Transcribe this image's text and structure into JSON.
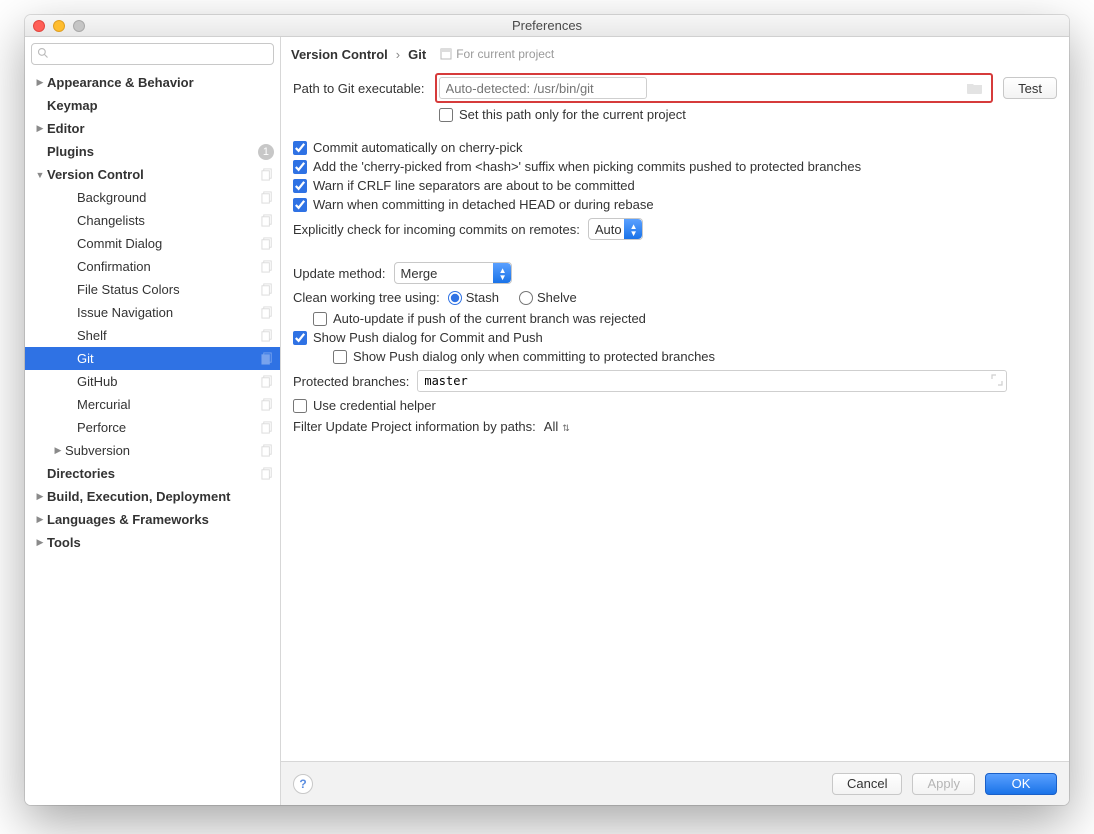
{
  "window": {
    "title": "Preferences"
  },
  "search": {
    "placeholder": ""
  },
  "sidebar": {
    "items": [
      {
        "label": "Appearance & Behavior",
        "bold": true,
        "arrow": "▶",
        "lvl": 0
      },
      {
        "label": "Keymap",
        "bold": true,
        "lvl": 0,
        "noarrow": true
      },
      {
        "label": "Editor",
        "bold": true,
        "arrow": "▶",
        "lvl": 0
      },
      {
        "label": "Plugins",
        "bold": true,
        "lvl": 0,
        "noarrow": true,
        "badge": "1"
      },
      {
        "label": "Version Control",
        "bold": true,
        "arrow": "▼",
        "lvl": 0,
        "copy": true
      },
      {
        "label": "Background",
        "lvl": 2,
        "copy": true
      },
      {
        "label": "Changelists",
        "lvl": 2,
        "copy": true
      },
      {
        "label": "Commit Dialog",
        "lvl": 2,
        "copy": true
      },
      {
        "label": "Confirmation",
        "lvl": 2,
        "copy": true
      },
      {
        "label": "File Status Colors",
        "lvl": 2,
        "copy": true
      },
      {
        "label": "Issue Navigation",
        "lvl": 2,
        "copy": true
      },
      {
        "label": "Shelf",
        "lvl": 2,
        "copy": true
      },
      {
        "label": "Git",
        "lvl": 2,
        "copy": true,
        "selected": true
      },
      {
        "label": "GitHub",
        "lvl": 2,
        "copy": true
      },
      {
        "label": "Mercurial",
        "lvl": 2,
        "copy": true
      },
      {
        "label": "Perforce",
        "lvl": 2,
        "copy": true
      },
      {
        "label": "Subversion",
        "lvl": 1,
        "arrow": "▶",
        "copy": true
      },
      {
        "label": "Directories",
        "bold": true,
        "lvl": 0,
        "noarrow": true,
        "copy": true
      },
      {
        "label": "Build, Execution, Deployment",
        "bold": true,
        "arrow": "▶",
        "lvl": 0
      },
      {
        "label": "Languages & Frameworks",
        "bold": true,
        "arrow": "▶",
        "lvl": 0
      },
      {
        "label": "Tools",
        "bold": true,
        "arrow": "▶",
        "lvl": 0
      }
    ]
  },
  "breadcrumb": {
    "root": "Version Control",
    "leaf": "Git",
    "hint": "For current project"
  },
  "path": {
    "label": "Path to Git executable:",
    "placeholder": "Auto-detected: /usr/bin/git",
    "test": "Test",
    "only_this_project": "Set this path only for the current project"
  },
  "checks": {
    "cherry_pick": "Commit automatically on cherry-pick",
    "cherry_suffix": "Add the 'cherry-picked from <hash>' suffix when picking commits pushed to protected branches",
    "crlf": "Warn if CRLF line separators are about to be committed",
    "detached": "Warn when committing in detached HEAD or during rebase"
  },
  "incoming": {
    "label": "Explicitly check for incoming commits on remotes:",
    "value": "Auto"
  },
  "update_method": {
    "label": "Update method:",
    "value": "Merge"
  },
  "clean": {
    "label": "Clean working tree using:",
    "opt1": "Stash",
    "opt2": "Shelve"
  },
  "push": {
    "auto_update": "Auto-update if push of the current branch was rejected",
    "show_push": "Show Push dialog for Commit and Push",
    "show_push_protected": "Show Push dialog only when committing to protected branches"
  },
  "protected": {
    "label": "Protected branches:",
    "value": "master"
  },
  "cred": {
    "label": "Use credential helper"
  },
  "filter": {
    "label": "Filter Update Project information by paths:",
    "value": "All"
  },
  "footer": {
    "cancel": "Cancel",
    "apply": "Apply",
    "ok": "OK"
  }
}
